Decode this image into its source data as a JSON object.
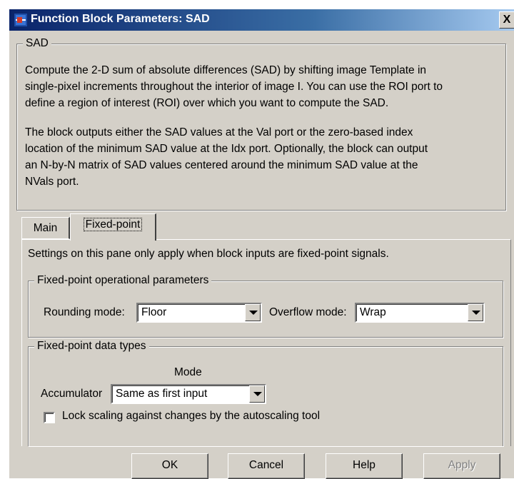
{
  "window": {
    "title": "Function Block Parameters: SAD",
    "close_symbol": "X"
  },
  "description_group": {
    "label": "SAD",
    "paragraph1_lines": [
      "Compute the 2-D sum of absolute differences (SAD) by shifting image Template  in",
      "single-pixel increments throughout the interior of image I. You can use the ROI port to",
      "define a region of interest (ROI) over which you want to compute the SAD."
    ],
    "paragraph2_lines": [
      "The block outputs either the SAD values at the Val port or the zero-based index",
      "location of the minimum SAD value at the Idx port.  Optionally, the block can output",
      "an N-by-N matrix of SAD values centered around the minimum SAD value at the",
      "NVals port."
    ]
  },
  "tabs": [
    {
      "label": "Main",
      "active": false
    },
    {
      "label": "Fixed-point",
      "active": true
    }
  ],
  "fixed_point_pane": {
    "info_text": "Settings on this pane only apply when block inputs are fixed-point signals.",
    "operational_group": {
      "label": "Fixed-point operational parameters",
      "rounding_label": "Rounding mode:",
      "rounding_value": "Floor",
      "overflow_label": "Overflow mode:",
      "overflow_value": "Wrap"
    },
    "data_types_group": {
      "label": "Fixed-point data types",
      "mode_header": "Mode",
      "accumulator_label": "Accumulator",
      "accumulator_value": "Same as first input",
      "lock_scaling_label": "Lock scaling against changes by the autoscaling tool",
      "lock_scaling_checked": false
    }
  },
  "buttons": {
    "ok": "OK",
    "cancel": "Cancel",
    "help": "Help",
    "apply": "Apply"
  },
  "colors": {
    "dialog_background": "#d4d0c8",
    "titlebar_start": "#0a246a",
    "titlebar_end": "#a6caf0",
    "disabled_text": "#808080"
  },
  "icons": {
    "app_icon": "simulink-block-icon",
    "close_icon": "close-icon",
    "dropdown_icon": "chevron-down-icon"
  }
}
